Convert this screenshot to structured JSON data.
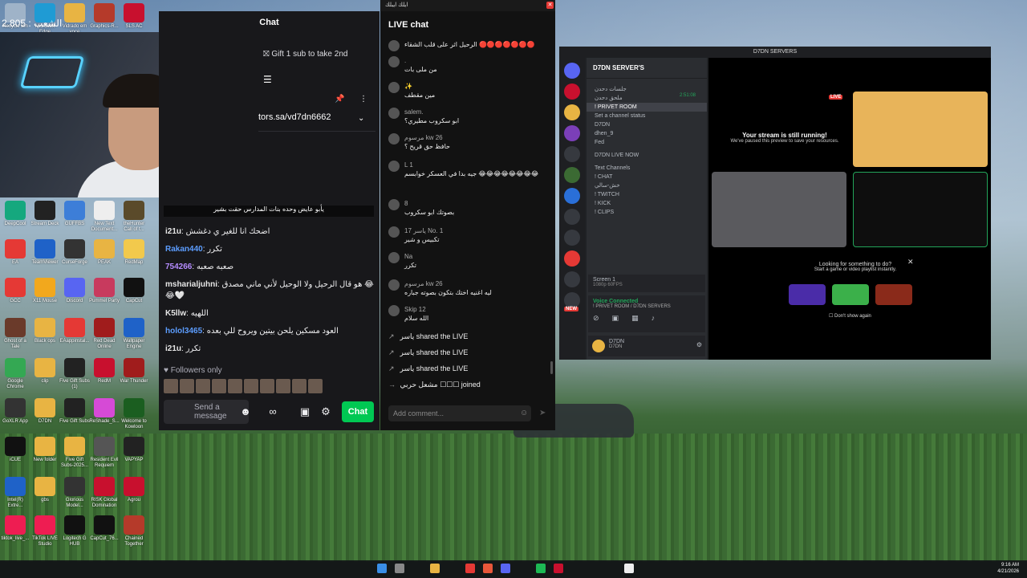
{
  "desktop": {
    "icons": [
      {
        "label": "Recycle Bin",
        "color": "#9fb3c8"
      },
      {
        "label": "Microsoft Edge",
        "color": "#1f9bd4"
      },
      {
        "label": "Vidrado em voce",
        "color": "#e8b443"
      },
      {
        "label": "Graphics-R...",
        "color": "#b53a2a"
      },
      {
        "label": "SLS AC",
        "color": "#c8102e"
      },
      {
        "label": "DeepCool",
        "color": "#15a87e"
      },
      {
        "label": "Stream Deck",
        "color": "#222"
      },
      {
        "label": "GUFFBS",
        "color": "#3d7ed8"
      },
      {
        "label": "New Text Document...",
        "color": "#eee"
      },
      {
        "label": "theHunter Call of t...",
        "color": "#5a4a2a"
      },
      {
        "label": "EA",
        "color": "#e53935"
      },
      {
        "label": "TeamViewer",
        "color": "#1f62c8"
      },
      {
        "label": "CurseForge",
        "color": "#333"
      },
      {
        "label": "PEAK",
        "color": "#e8b443"
      },
      {
        "label": "RedMap",
        "color": "#f2c94c"
      },
      {
        "label": "GCC",
        "color": "#e53935"
      },
      {
        "label": "X11 Mouse",
        "color": "#f2a81d"
      },
      {
        "label": "Discord",
        "color": "#5865f2"
      },
      {
        "label": "Pummel Party",
        "color": "#c83a5e"
      },
      {
        "label": "CapCut",
        "color": "#111"
      },
      {
        "label": "Ghost of a Tale",
        "color": "#6a3a2a"
      },
      {
        "label": "Black ops",
        "color": "#e8b443"
      },
      {
        "label": "EAappinstal...",
        "color": "#e53935"
      },
      {
        "label": "Red Dead Online",
        "color": "#a01c1c"
      },
      {
        "label": "Wallpaper Engine",
        "color": "#1f62c8"
      },
      {
        "label": "Google Chrome",
        "color": "#34a853"
      },
      {
        "label": "clip",
        "color": "#e8b443"
      },
      {
        "label": "Five Gift Subs (1)",
        "color": "#222"
      },
      {
        "label": "RedM",
        "color": "#c8102e"
      },
      {
        "label": "War Thunder",
        "color": "#a01c1c"
      },
      {
        "label": "GoXLR App",
        "color": "#333"
      },
      {
        "label": "D7DN",
        "color": "#e8b443"
      },
      {
        "label": "Five Gift Subs",
        "color": "#222"
      },
      {
        "label": "ReShade_S...",
        "color": "#d64ad6"
      },
      {
        "label": "Welcome to Kowloon",
        "color": "#1b5e20"
      },
      {
        "label": "iCUE",
        "color": "#111"
      },
      {
        "label": "New folder",
        "color": "#e8b443"
      },
      {
        "label": "Five Gift Subs-2025...",
        "color": "#e8b443"
      },
      {
        "label": "Resident Evil Requiem",
        "color": "#555"
      },
      {
        "label": "VAPYAP",
        "color": "#222"
      },
      {
        "label": "Intel(R) Extre...",
        "color": "#1f62c8"
      },
      {
        "label": "gbs",
        "color": "#e8b443"
      },
      {
        "label": "Glorious Model...",
        "color": "#333"
      },
      {
        "label": "RISK Global Domination",
        "color": "#c8102e"
      },
      {
        "label": "Agrou",
        "color": "#c8102e"
      },
      {
        "label": "tiktok_live_...",
        "color": "#ee1d52"
      },
      {
        "label": "TikTok LIVE Studio",
        "color": "#ee1d52"
      },
      {
        "label": "Logitech G HUB",
        "color": "#111"
      },
      {
        "label": "CapCut_76...",
        "color": "#111"
      },
      {
        "label": "Chained Together",
        "color": "#b53a2a"
      }
    ]
  },
  "webcam": {
    "overlay": "2.805 : الشعب"
  },
  "twitch": {
    "header": "Chat",
    "gift": "Gift 1 sub to take 2nd",
    "pinned_link": "tors.sa/vd7dn6662",
    "banner": "يأبو عايض وحده بنات المدارس حقت بشير",
    "messages": [
      {
        "user": "i21u",
        "text": "اضحك انا للغير ي دغشش",
        "color": "#e6e6e6"
      },
      {
        "user": "Rakan440",
        "text": "تكرر",
        "color": "#5c9dff"
      },
      {
        "user": "754266",
        "text": "صعبه صعبه",
        "color": "#b58cff"
      },
      {
        "user": "msharialjuhni",
        "text": "هو قال الرحيل ولا الوحيل لأني ماني مصدق 😂😂🤍",
        "color": "#e6e6e6"
      },
      {
        "user": "K5llw",
        "text": "اللهيه",
        "color": "#e6e6e6"
      },
      {
        "user": "holol3465",
        "text": "العود مسكين يلحن بيتين ويروح للي بعده",
        "color": "#5c9dff"
      },
      {
        "user": "i21u",
        "text": "تكرر",
        "color": "#e6e6e6"
      }
    ],
    "followers": "Followers only",
    "input_placeholder": "Send a message",
    "chat_button": "Chat"
  },
  "tiktok": {
    "window_title": "ايلك ايبلك",
    "title": "LIVE chat",
    "messages": [
      {
        "name": "",
        "text": "الرحيل اثر على قلب الشقاء 🔴🔴🔴🔴🔴🔴🔴"
      },
      {
        "name": ".",
        "text": "من ملى بات"
      },
      {
        "name": "✨",
        "text": "مين مقطف"
      },
      {
        "name": "salem.",
        "text": "ابو سكروب مطيري؟"
      },
      {
        "name": "مرسوم kw 26",
        "text": "حافظ حق قريح ؟"
      },
      {
        "name": "L 1",
        "text": "جيه بدا في العسكر خوابسم 😂😂😂😂😂😂😂😂"
      },
      {
        "name": "8",
        "text": "بصوتك ابو سكروب"
      },
      {
        "name": "ياسر 17 No. 1",
        "text": "تكبيس و شير"
      },
      {
        "name": "Na",
        "text": "تكرر"
      },
      {
        "name": "مرسوم kw 26",
        "text": "ليه اغنيه اختك بتكون بصوته جباره"
      },
      {
        "name": "Skip 12",
        "text": "الله سلام"
      }
    ],
    "shares": [
      {
        "user": "ياسر",
        "text": "shared the LIVE"
      },
      {
        "user": "ياسر",
        "text": "shared the LIVE"
      },
      {
        "user": "ياسر",
        "text": "shared the LIVE"
      }
    ],
    "joined": {
      "user": "مشعل حربي ☐☐☐",
      "text": "joined"
    },
    "comment_placeholder": "Add comment..."
  },
  "discord": {
    "window_title": "D7DN SERVERS",
    "server_name": "D7DN SERVER'S",
    "channels": [
      {
        "name": "جلسات دحدن",
        "selected": false
      },
      {
        "name": "ملحق دحدن",
        "selected": false
      },
      {
        "name": "! PRIVET ROOM",
        "selected": true
      },
      {
        "name": "Set a channel status",
        "selected": false
      },
      {
        "name": "D7DN",
        "selected": false
      },
      {
        "name": "dhen_9",
        "selected": false
      },
      {
        "name": "Fed",
        "selected": false
      },
      {
        "name": "D7DN LIVE NOW",
        "selected": false
      },
      {
        "name": "Text Channels",
        "selected": false
      },
      {
        "name": "! CHAT",
        "selected": false
      },
      {
        "name": "خش-سالي",
        "selected": false
      },
      {
        "name": "! TWITCH",
        "selected": false
      },
      {
        "name": "! KICK",
        "selected": false
      },
      {
        "name": "! CLIPS",
        "selected": false
      }
    ],
    "timer": "2:51:08",
    "live_tag": "LIVE",
    "new_tag": "NEW",
    "screen_share": "Screen 1",
    "screen_share_sub": "1080p 60FPS",
    "voice_status": "Voice Connected",
    "voice_room": "! PRIVET ROOM / D7DN SERVERS",
    "user_name": "D7DN",
    "user_status": "D7DN",
    "stream_msg": "Your stream is still running!",
    "stream_sub": "We've paused this preview to save your resources.",
    "activity_title": "Looking for something to do?",
    "activity_sub": "Start a game or video playlist instantly.",
    "dont_show": "Don't show again"
  },
  "taskbar": {
    "time": "9:16 AM",
    "date": "4/21/2026"
  }
}
